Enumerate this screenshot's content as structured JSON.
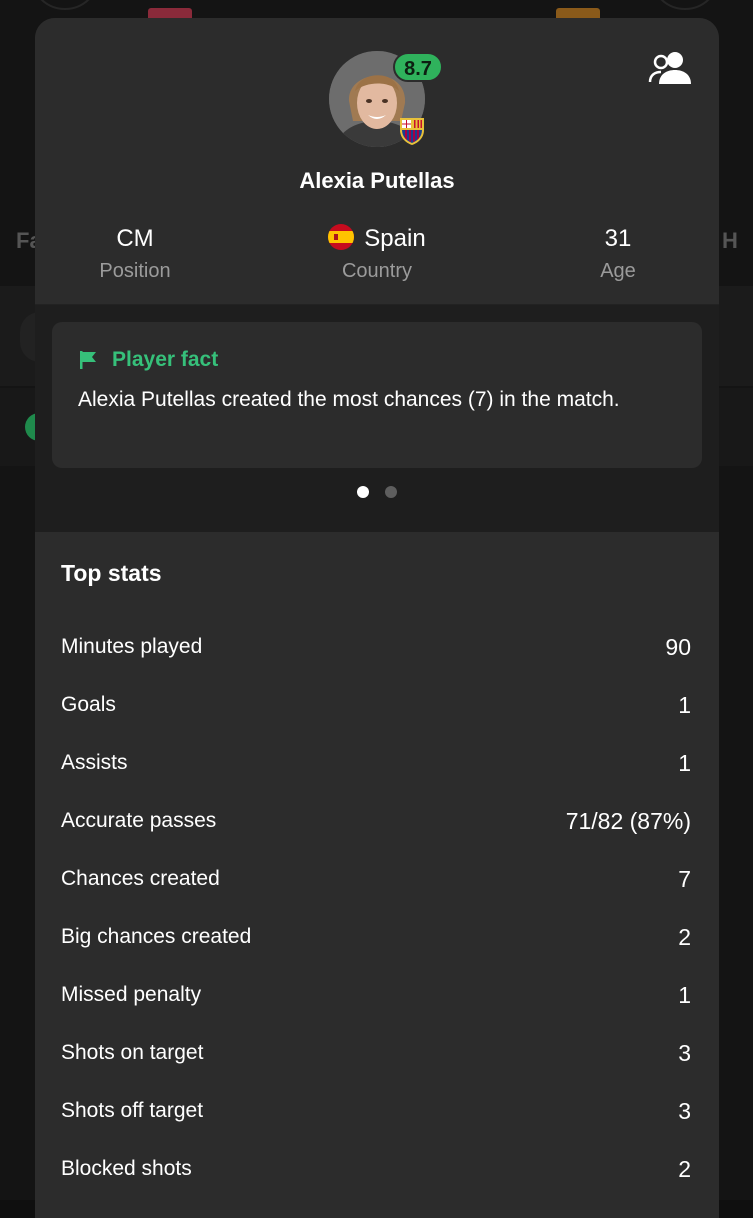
{
  "background": {
    "left_tab_fragment": "Fa",
    "right_tab_fragment": "H"
  },
  "player": {
    "name": "Alexia Putellas",
    "rating": "8.7",
    "position_value": "CM",
    "position_label": "Position",
    "country_value": "Spain",
    "country_label": "Country",
    "age_value": "31",
    "age_label": "Age"
  },
  "fact": {
    "title": "Player fact",
    "text": "Alexia Putellas created the most chances (7) in the match.",
    "active_index": 1,
    "total": 2
  },
  "top_stats": {
    "title": "Top stats",
    "rows": [
      {
        "label": "Minutes played",
        "value": "90"
      },
      {
        "label": "Goals",
        "value": "1"
      },
      {
        "label": "Assists",
        "value": "1"
      },
      {
        "label": "Accurate passes",
        "value": "71/82 (87%)"
      },
      {
        "label": "Chances created",
        "value": "7"
      },
      {
        "label": "Big chances created",
        "value": "2"
      },
      {
        "label": "Missed penalty",
        "value": "1"
      },
      {
        "label": "Shots on target",
        "value": "3"
      },
      {
        "label": "Shots off target",
        "value": "3"
      },
      {
        "label": "Blocked shots",
        "value": "2"
      }
    ]
  },
  "colors": {
    "accent_green": "#36c07a",
    "rating_green": "#2fb25c",
    "sheet_bg": "#2c2c2c",
    "muted_text": "#9b9b9b"
  },
  "icons": {
    "compare": "person-compare-icon",
    "fact": "flag-icon",
    "club": "club-crest-icon",
    "country": "spain-flag-icon"
  }
}
